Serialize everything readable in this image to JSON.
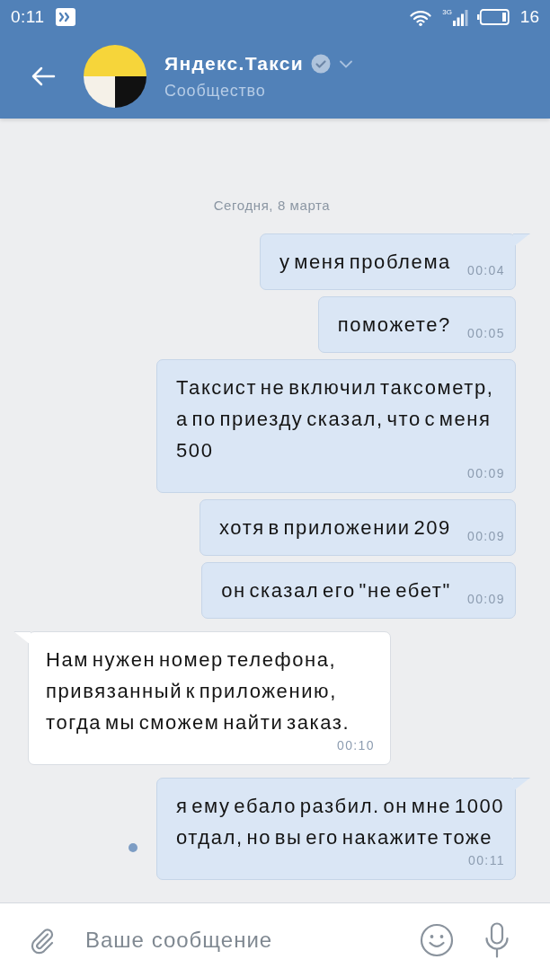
{
  "status_bar": {
    "time": "0:11",
    "network": "3G",
    "battery": "16"
  },
  "header": {
    "title": "Яндекс.Такси",
    "subtitle": "Сообщество"
  },
  "date": "Сегодня, 8 марта",
  "messages": [
    {
      "kind": "outgoing",
      "text": "у меня проблема",
      "time": "00:04",
      "unread": false
    },
    {
      "kind": "outgoing",
      "text": "поможете?",
      "time": "00:05",
      "unread": false
    },
    {
      "kind": "outgoing",
      "text": "Таксист не включил таксометр, а по приезду сказал, что с меня 500",
      "time": "00:09",
      "unread": false
    },
    {
      "kind": "outgoing",
      "text": "хотя в приложении 209",
      "time": "00:09",
      "unread": false
    },
    {
      "kind": "outgoing",
      "text": "он сказал его \"не ебет\"",
      "time": "00:09",
      "unread": false
    },
    {
      "kind": "incoming",
      "text": "Нам нужен номер телефона, привязанный к приложению, тогда мы сможем найти заказ.",
      "time": "00:10",
      "unread": false
    },
    {
      "kind": "outgoing",
      "text": "я ему ебало разбил. он мне 1000 отдал, но вы его накажите тоже",
      "time": "00:11",
      "unread": true
    }
  ],
  "composer": {
    "placeholder": "Ваше сообщение"
  }
}
